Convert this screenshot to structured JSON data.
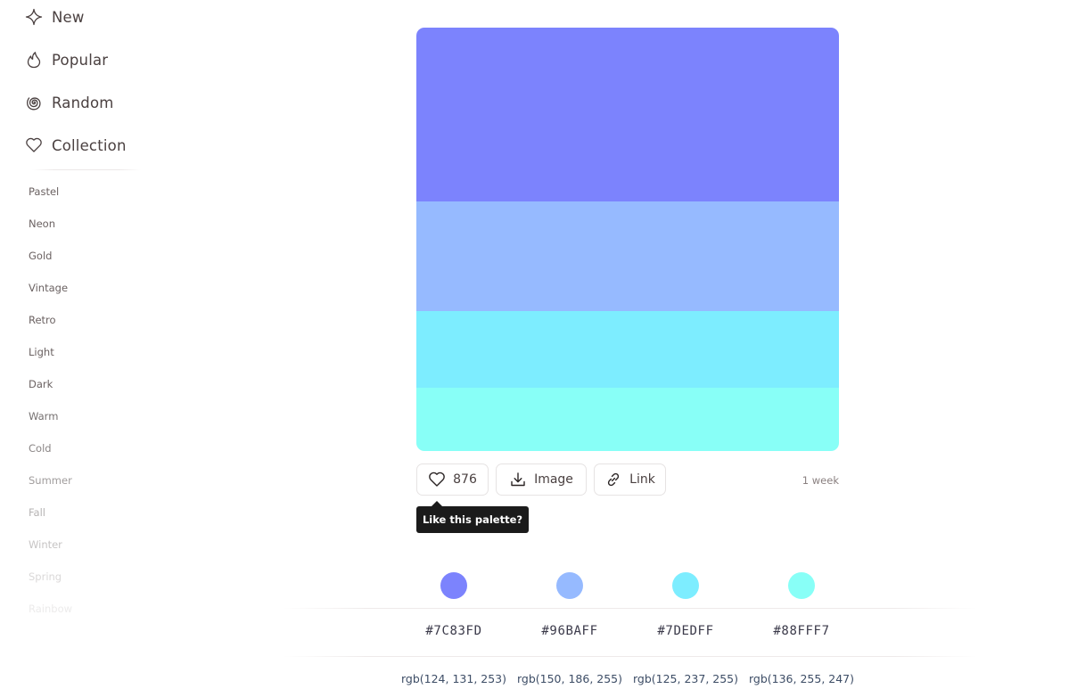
{
  "sidebar": {
    "nav": [
      {
        "label": "New",
        "icon": "sparkle-icon"
      },
      {
        "label": "Popular",
        "icon": "flame-icon"
      },
      {
        "label": "Random",
        "icon": "spiral-icon"
      },
      {
        "label": "Collection",
        "icon": "heart-icon"
      }
    ],
    "tags": [
      {
        "label": "Pastel",
        "color": "#6b6262"
      },
      {
        "label": "Neon",
        "color": "#6b6262"
      },
      {
        "label": "Gold",
        "color": "#6b6262"
      },
      {
        "label": "Vintage",
        "color": "#6b6262"
      },
      {
        "label": "Retro",
        "color": "#6b6262"
      },
      {
        "label": "Light",
        "color": "#6b6262"
      },
      {
        "label": "Dark",
        "color": "#6b6262"
      },
      {
        "label": "Warm",
        "color": "#757070"
      },
      {
        "label": "Cold",
        "color": "#8a8585"
      },
      {
        "label": "Summer",
        "color": "#a09c9c"
      },
      {
        "label": "Fall",
        "color": "#b6b3b3"
      },
      {
        "label": "Winter",
        "color": "#c6c4c4"
      },
      {
        "label": "Spring",
        "color": "#dad8d8"
      },
      {
        "label": "Rainbow",
        "color": "#ecebeb"
      }
    ]
  },
  "palette": {
    "colors": [
      {
        "hex": "#7C83FD",
        "rgb": "rgb(124, 131, 253)"
      },
      {
        "hex": "#96BAFF",
        "rgb": "rgb(150, 186, 255)"
      },
      {
        "hex": "#7DEDFF",
        "rgb": "rgb(125, 237, 255)"
      },
      {
        "hex": "#88FFF7",
        "rgb": "rgb(136, 255, 247)"
      }
    ],
    "likes": "876",
    "image_label": "Image",
    "link_label": "Link",
    "age": "1 week",
    "tooltip": "Like this palette?"
  }
}
